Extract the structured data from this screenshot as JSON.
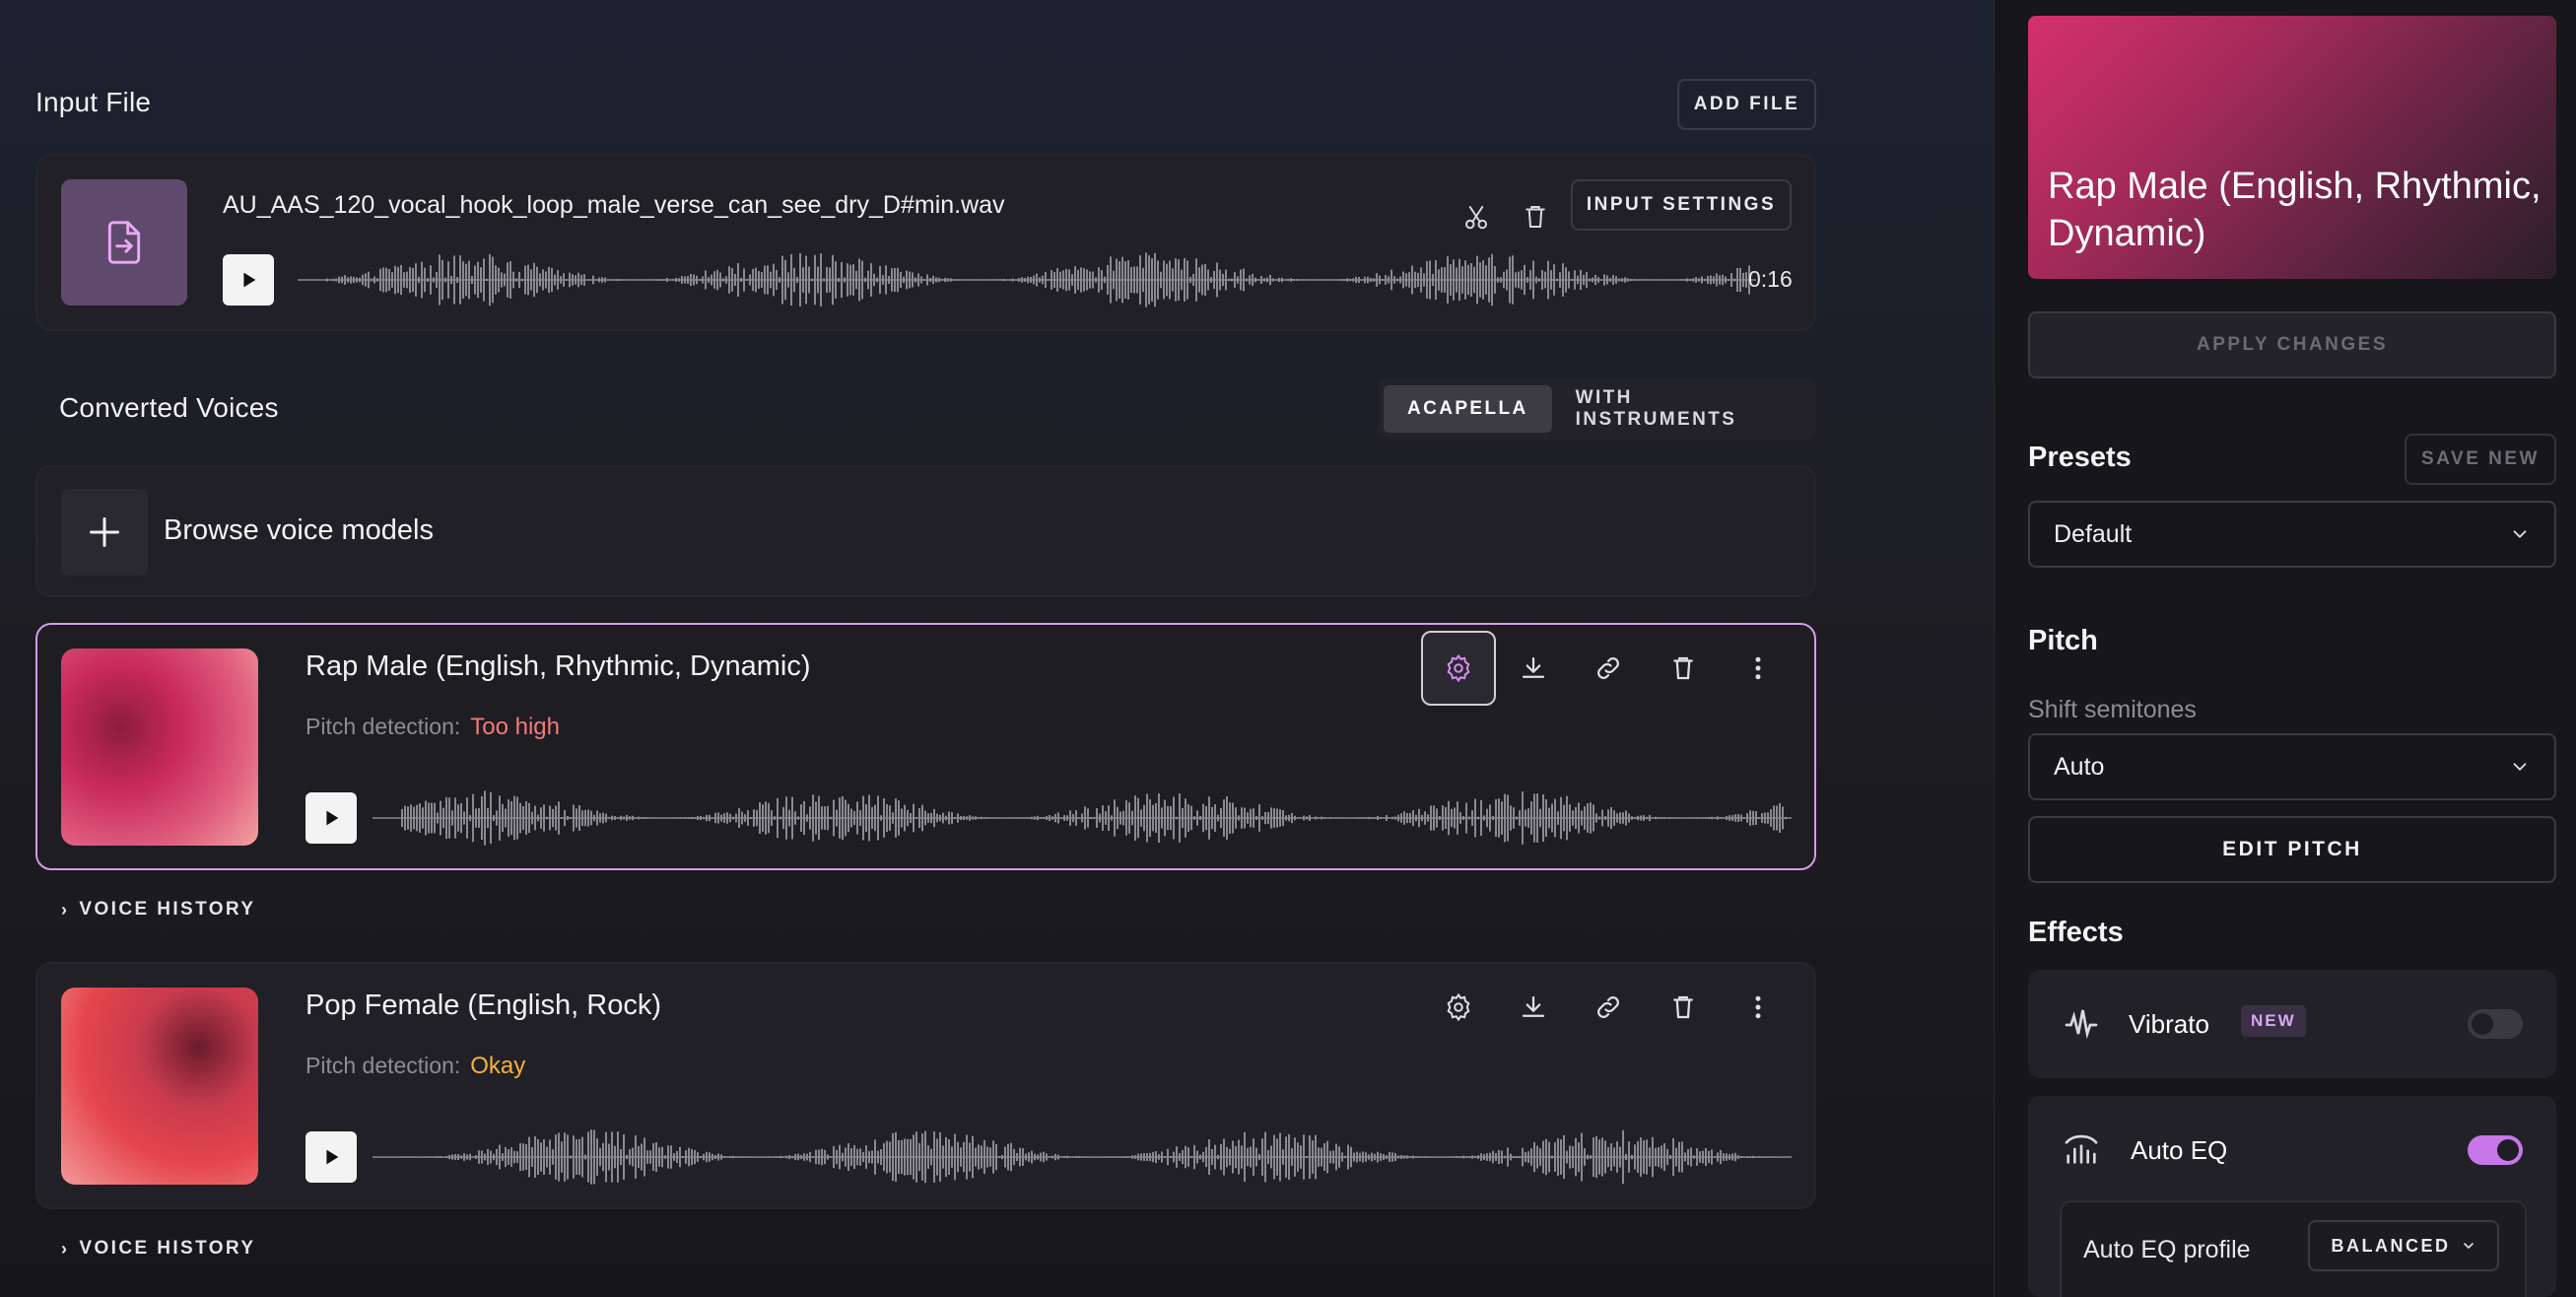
{
  "input": {
    "title": "Input File",
    "add_file": "ADD FILE",
    "filename": "AU_AAS_120_vocal_hook_loop_male_verse_can_see_dry_D#min.wav",
    "input_settings": "INPUT SETTINGS",
    "duration": "0:16",
    "icons": [
      "file-import-icon",
      "scissors-icon",
      "trash-icon",
      "play-icon"
    ]
  },
  "converted": {
    "title": "Converted Voices",
    "tabs": [
      "ACAPELLA",
      "WITH INSTRUMENTS"
    ],
    "active_tab": "ACAPELLA",
    "browse": "Browse voice models"
  },
  "voices": [
    {
      "name": "Rap Male (English, Rhythmic, Dynamic)",
      "pitch_label": "Pitch detection:",
      "pitch_value": "Too high",
      "pitch_color": "#f07b7b",
      "selected": true,
      "history": "VOICE HISTORY"
    },
    {
      "name": "Pop Female (English, Rock)",
      "pitch_label": "Pitch detection:",
      "pitch_value": "Okay",
      "pitch_color": "#f3b23e",
      "selected": false,
      "history": "VOICE HISTORY"
    }
  ],
  "sidebar": {
    "hero_title": "Rap Male (English, Rhythmic, Dynamic)",
    "apply": "APPLY CHANGES",
    "presets_title": "Presets",
    "save_new": "SAVE NEW",
    "preset_value": "Default",
    "pitch_title": "Pitch",
    "shift_label": "Shift semitones",
    "shift_value": "Auto",
    "edit_pitch": "EDIT PITCH",
    "effects_title": "Effects",
    "vibrato_label": "Vibrato",
    "vibrato_badge": "NEW",
    "vibrato_on": false,
    "autoeq_label": "Auto EQ",
    "autoeq_on": true,
    "autoeq_profile_label": "Auto EQ profile",
    "autoeq_profile_value": "BALANCED"
  },
  "colors": {
    "accent": "#d88ef0",
    "selected_border": "#d79be9",
    "toggle_on": "#c777ea"
  }
}
